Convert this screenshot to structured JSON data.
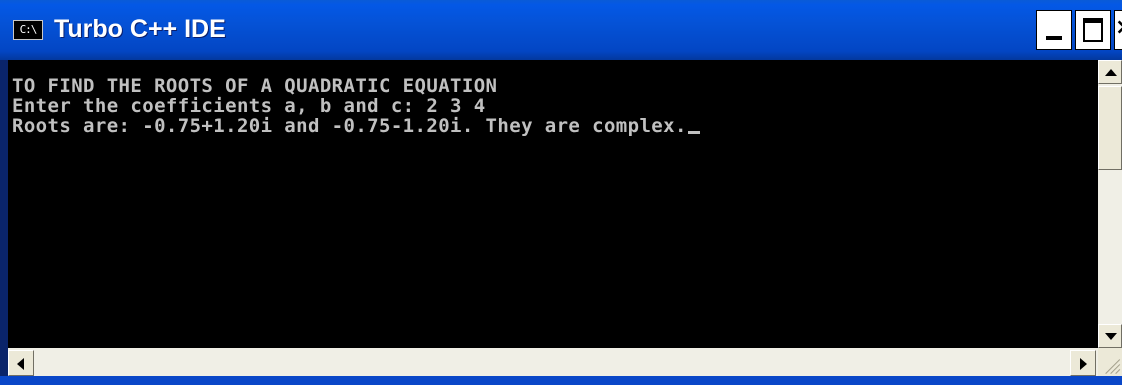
{
  "window": {
    "title": "Turbo C++ IDE",
    "icon": "cmd-console-icon",
    "icon_text": "C:\\",
    "buttons": {
      "minimize": "minimize-icon",
      "maximize": "maximize-icon",
      "close": "close-icon",
      "close_glyph": "×"
    }
  },
  "console": {
    "lines": [
      "TO FIND THE ROOTS OF A QUADRATIC EQUATION",
      "Enter the coefficients a, b and c: 2 3 4",
      "Roots are: -0.75+1.20i and -0.75-1.20i. They are complex."
    ],
    "text_color": "#c0c0c0",
    "background": "#000000"
  },
  "colors": {
    "titlebar": "#0458e6",
    "frame": "#0a246a"
  }
}
